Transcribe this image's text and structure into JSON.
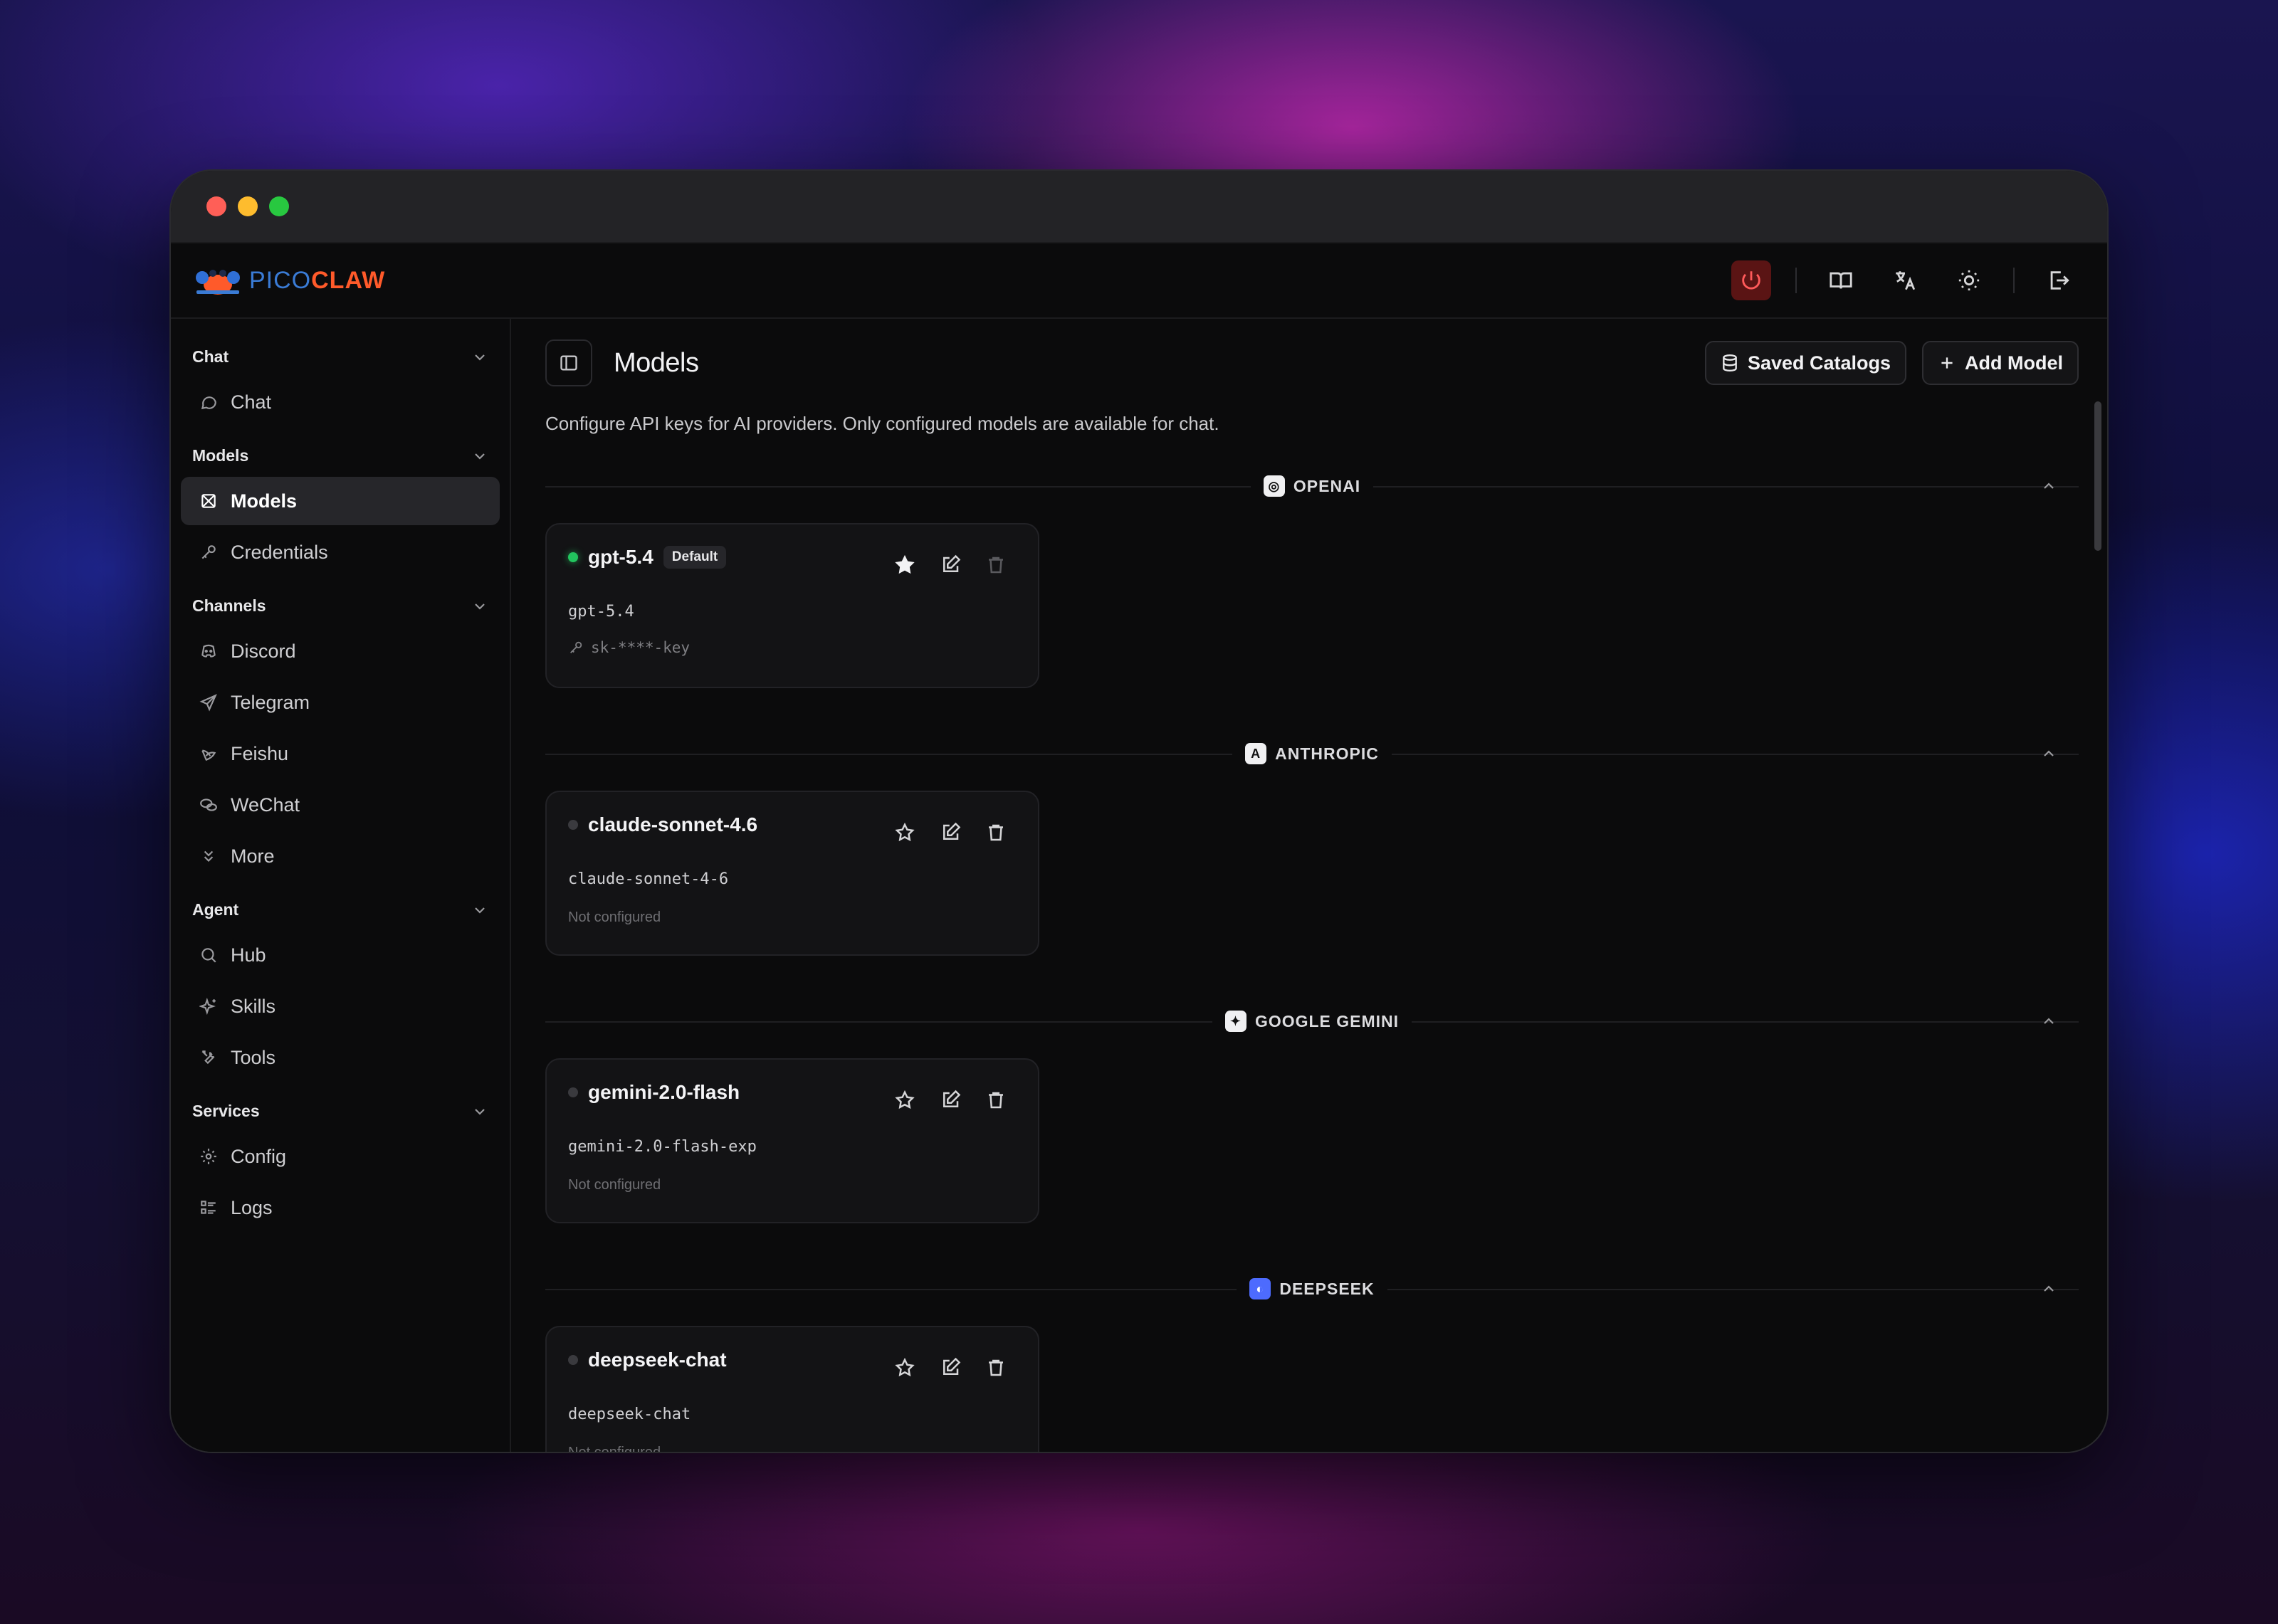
{
  "brand": {
    "pico": "PICO",
    "claw": "CLAW"
  },
  "header": {
    "icons": [
      "power-icon",
      "book-icon",
      "translate-icon",
      "sun-icon",
      "logout-icon"
    ]
  },
  "sidebar": {
    "groups": [
      {
        "title": "Chat",
        "items": [
          {
            "label": "Chat",
            "icon": "chat-bubble-icon"
          }
        ]
      },
      {
        "title": "Models",
        "items": [
          {
            "label": "Models",
            "icon": "models-icon",
            "active": true
          },
          {
            "label": "Credentials",
            "icon": "key-icon"
          }
        ]
      },
      {
        "title": "Channels",
        "items": [
          {
            "label": "Discord",
            "icon": "discord-icon"
          },
          {
            "label": "Telegram",
            "icon": "send-icon"
          },
          {
            "label": "Feishu",
            "icon": "feishu-icon"
          },
          {
            "label": "WeChat",
            "icon": "wechat-icon"
          },
          {
            "label": "More",
            "icon": "chevrons-down-icon"
          }
        ]
      },
      {
        "title": "Agent",
        "items": [
          {
            "label": "Hub",
            "icon": "search-icon"
          },
          {
            "label": "Skills",
            "icon": "sparkles-icon"
          },
          {
            "label": "Tools",
            "icon": "tools-icon"
          }
        ]
      },
      {
        "title": "Services",
        "items": [
          {
            "label": "Config",
            "icon": "gear-icon"
          },
          {
            "label": "Logs",
            "icon": "list-icon"
          }
        ]
      }
    ]
  },
  "main": {
    "title": "Models",
    "saved_catalogs": "Saved Catalogs",
    "add_model": "Add Model",
    "subtitle": "Configure API keys for AI providers. Only configured models are available for chat.",
    "providers": [
      {
        "name": "OPENAI",
        "badge": "◎",
        "model": {
          "name": "gpt-5.4",
          "default_label": "Default",
          "id": "gpt-5.4",
          "key": "sk-****-key",
          "configured": true
        }
      },
      {
        "name": "ANTHROPIC",
        "badge": "A",
        "model": {
          "name": "claude-sonnet-4.6",
          "id": "claude-sonnet-4-6",
          "status": "Not configured",
          "configured": false
        }
      },
      {
        "name": "GOOGLE GEMINI",
        "badge": "✦",
        "model": {
          "name": "gemini-2.0-flash",
          "id": "gemini-2.0-flash-exp",
          "status": "Not configured",
          "configured": false
        }
      },
      {
        "name": "DEEPSEEK",
        "badge": "◐",
        "model": {
          "name": "deepseek-chat",
          "id": "deepseek-chat",
          "status": "Not configured",
          "configured": false
        }
      }
    ]
  }
}
